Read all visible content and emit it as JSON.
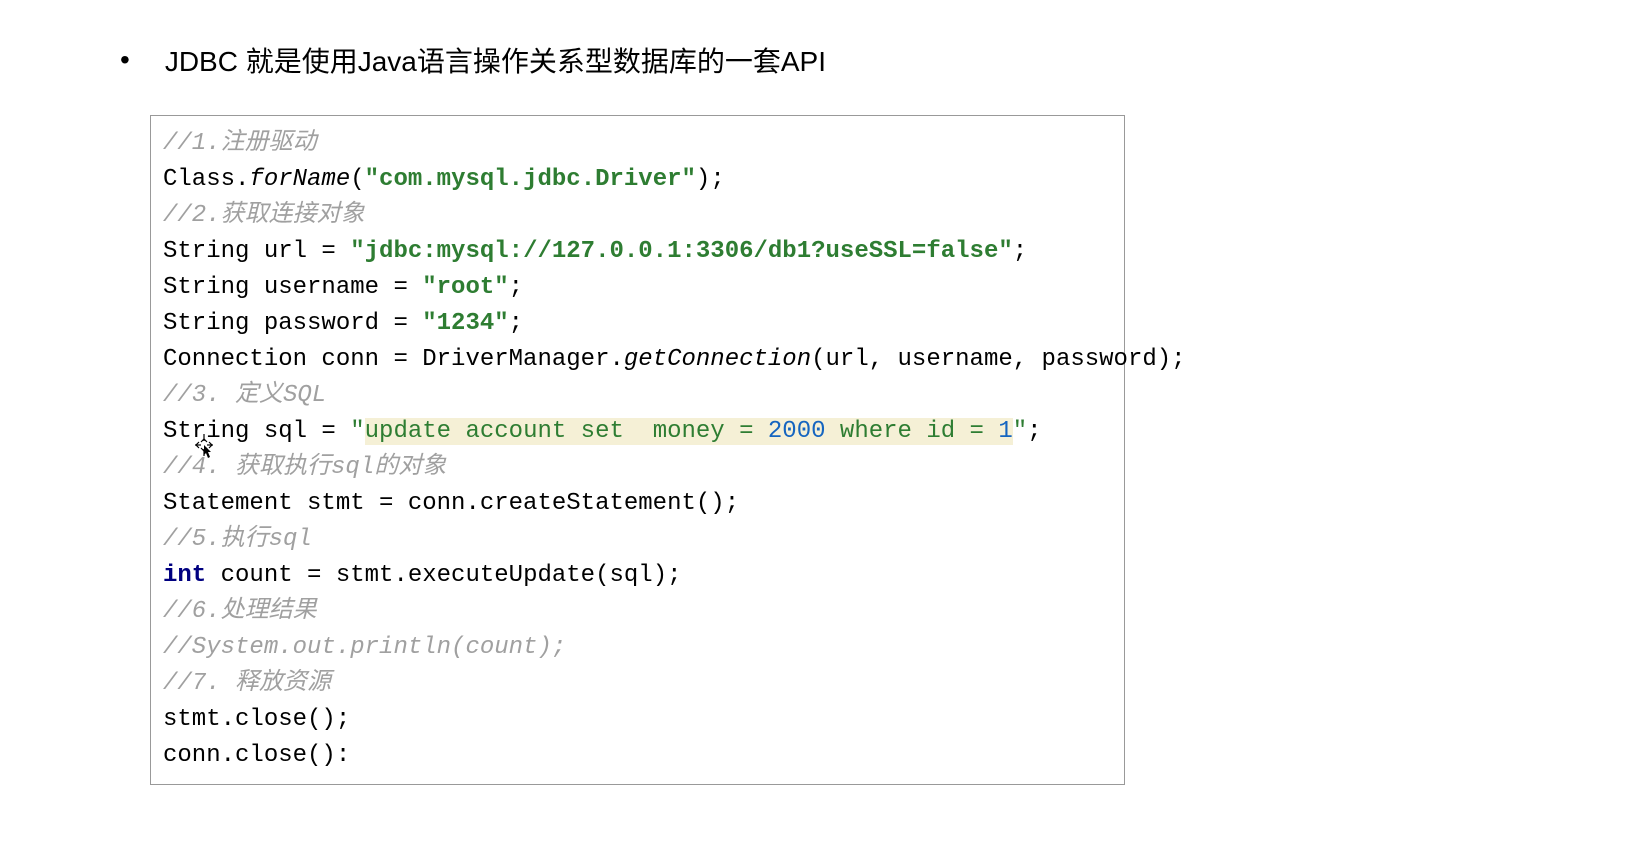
{
  "heading": "JDBC 就是使用Java语言操作关系型数据库的一套API",
  "code": {
    "c1": "//1.注册驱动",
    "l1a": "Class.",
    "l1b": "forName",
    "l1c": "(",
    "l1d": "\"com.mysql.jdbc.Driver\"",
    "l1e": ");",
    "c2": "//2.获取连接对象",
    "l2": "String url = ",
    "l2s": "\"jdbc:mysql://127.0.0.1:3306/db1?useSSL=false\"",
    "l2e": ";",
    "l3": "String username = ",
    "l3s": "\"root\"",
    "l3e": ";",
    "l4": "String password = ",
    "l4s": "\"1234\"",
    "l4e": ";",
    "l5a": "Connection conn = DriverManager.",
    "l5b": "getConnection",
    "l5c": "(url, username, password);",
    "c3": "//3. 定义SQL",
    "l6a": "String sql = ",
    "l6b": "\"",
    "l6c": "update account set  money = ",
    "l6d": "2000",
    "l6e": " where id = ",
    "l6f": "1",
    "l6g": "\"",
    "l6h": ";",
    "c4": "//4. 获取执行sql的对象",
    "l7": "Statement stmt = conn.createStatement();",
    "c5": "//5.执行sql",
    "l8a": "int",
    "l8b": " count = stmt.executeUpdate(sql);",
    "c6": "//6.处理结果",
    "c6b": "//System.out.println(count);",
    "c7": "//7. 释放资源",
    "l9": "stmt.close();",
    "l10": "conn.close():"
  }
}
